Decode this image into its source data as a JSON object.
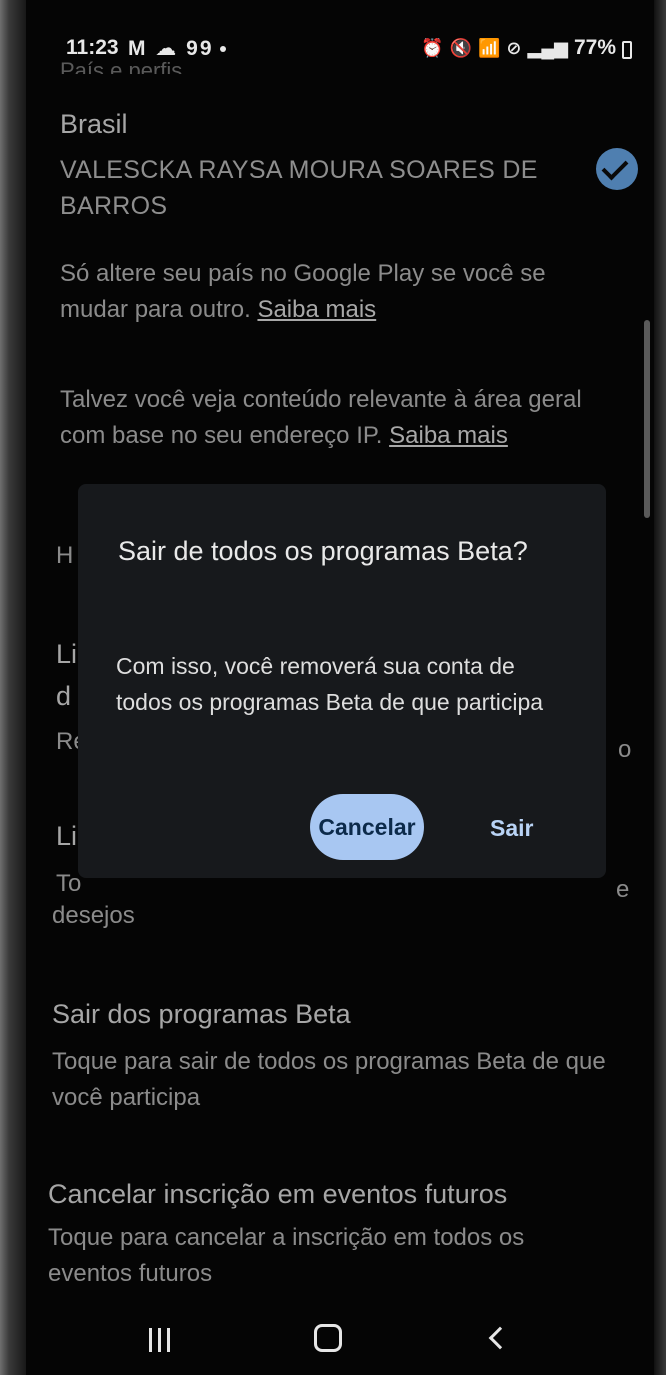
{
  "status_bar": {
    "time": "11:23",
    "left_icons": "M ☁ 99",
    "battery": "77%"
  },
  "settings": {
    "section_header_partial": "País e perfis",
    "country": "Brasil",
    "account_name": "VALESCKA RAYSA MOURA SOARES DE BARROS",
    "country_note": "Só altere seu país no Google Play se você se mudar para outro.",
    "country_note_link": "Saiba mais",
    "ip_note": "Talvez você veja conteúdo relevante à área geral com base no seu endereço IP.",
    "ip_note_link": "Saiba mais",
    "partial_h": "H",
    "partial_li_1": "Li",
    "partial_d": "d",
    "partial_r": "Re",
    "partial_o": "o",
    "partial_li_2": "Li",
    "partial_to": "To",
    "partial_e": "e",
    "desejos": "desejos",
    "leave_beta_title": "Sair dos programas Beta",
    "leave_beta_desc": "Toque para sair de todos os programas Beta de que você participa",
    "cancel_events_title": "Cancelar inscrição em eventos futuros",
    "cancel_events_desc": "Toque para cancelar a inscrição em todos os eventos futuros"
  },
  "dialog": {
    "title": "Sair de todos os programas Beta?",
    "body": "Com isso, você removerá sua conta de todos os programas Beta de que participa",
    "cancel_label": "Cancelar",
    "confirm_label": "Sair"
  },
  "colors": {
    "dialog_bg": "#17191c",
    "primary_button": "#a8c7f2",
    "check_badge": "#4f7fb0"
  },
  "icons": {
    "checkmark": "check-circle-icon",
    "recents": "recents-icon",
    "home": "home-icon",
    "back": "back-icon"
  }
}
